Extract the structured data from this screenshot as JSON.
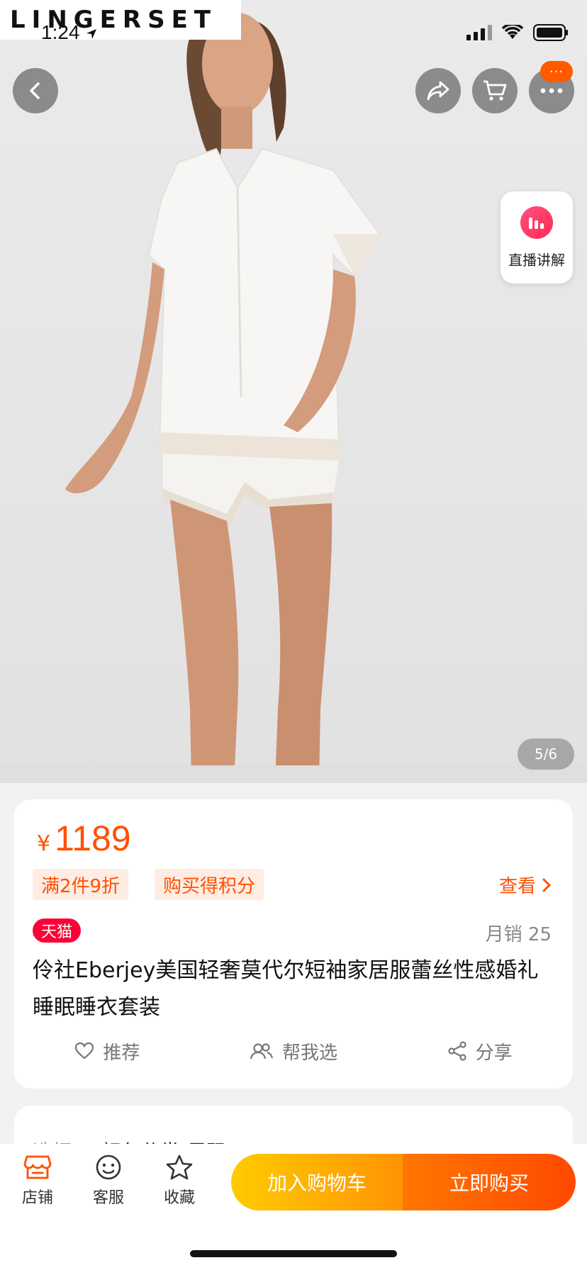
{
  "brand_logo": "LINGERSET",
  "status": {
    "time": "1:24"
  },
  "top_nav": {
    "back_icon": "chevron-left-icon",
    "share_icon": "share-icon",
    "cart_icon": "cart-icon",
    "more_icon": "more-icon",
    "more_badge": "···"
  },
  "live": {
    "label": "直播讲解",
    "icon": "live-bars-icon"
  },
  "gallery": {
    "current": 5,
    "total": 6,
    "pager_text": "5/6"
  },
  "product": {
    "currency": "¥",
    "price": "1189",
    "promos": [
      "满2件9折",
      "购买得积分"
    ],
    "see_more": "查看",
    "store_badge": "天猫",
    "monthly_sales": "月销 25",
    "title": "伶社Eberjey美国轻奢莫代尔短袖家居服蕾丝性感婚礼睡眠睡衣套装",
    "actions": [
      {
        "label": "推荐",
        "icon": "heart-icon"
      },
      {
        "label": "帮我选",
        "icon": "group-icon"
      },
      {
        "label": "分享",
        "icon": "share-nodes-icon"
      }
    ]
  },
  "selection": {
    "label": "选择",
    "value": "颜色分类/尺码"
  },
  "bottom_bar": {
    "tabs": [
      {
        "label": "店铺",
        "icon": "store-icon"
      },
      {
        "label": "客服",
        "icon": "service-icon"
      },
      {
        "label": "收藏",
        "icon": "star-icon"
      }
    ],
    "add_to_cart": "加入购物车",
    "buy_now": "立即购买"
  },
  "colors": {
    "accent": "#ff5000",
    "tmall": "#ff0036",
    "cart_btn": "#ffaa00",
    "buy_btn": "#ff5500"
  }
}
